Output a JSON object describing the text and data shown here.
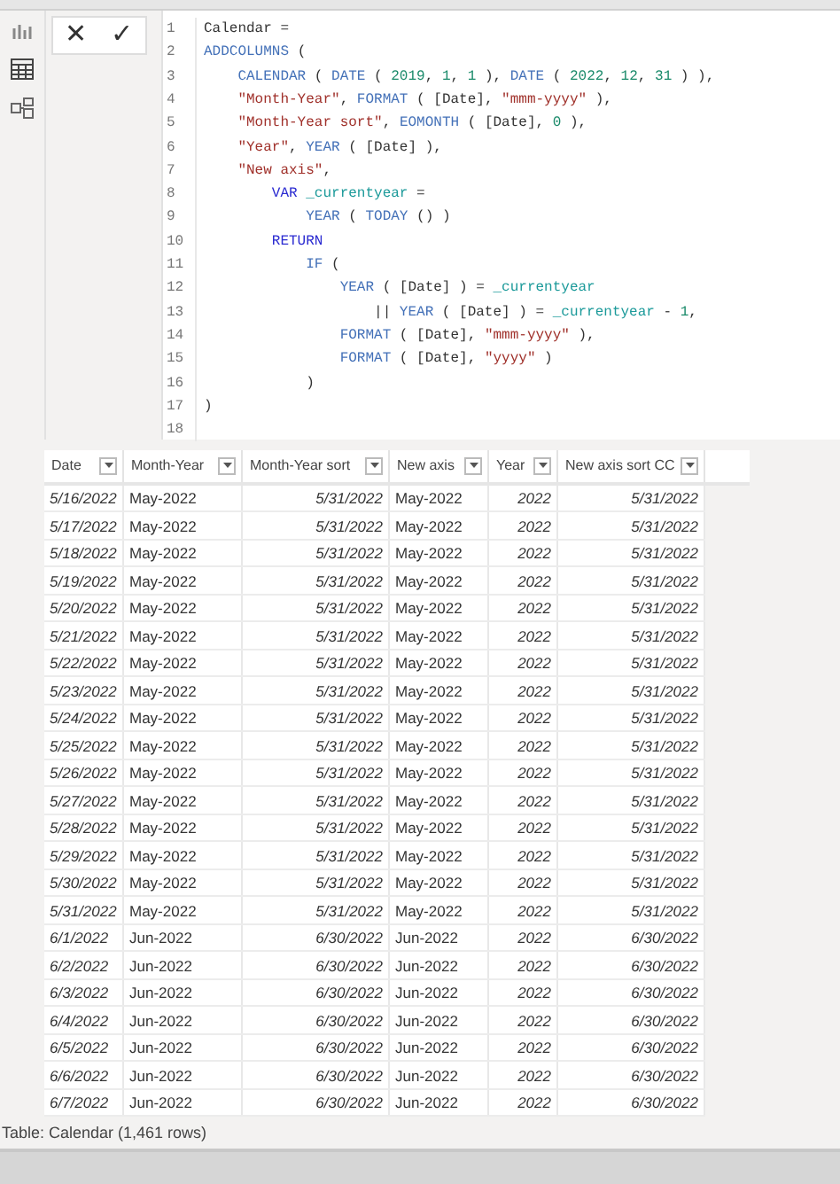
{
  "formula_bar": {
    "cancel": "✕",
    "commit": "✓"
  },
  "code": [
    {
      "n": "1",
      "tokens": [
        {
          "kind": "txt",
          "t": "Calendar ="
        }
      ]
    },
    {
      "n": "2",
      "tokens": [
        {
          "kind": "fn",
          "t": "ADDCOLUMNS"
        },
        {
          "kind": "txt",
          "t": " ("
        }
      ]
    },
    {
      "n": "3",
      "tokens": [
        {
          "kind": "fn",
          "t": "    CALENDAR"
        },
        {
          "kind": "txt",
          "t": " ( "
        },
        {
          "kind": "fn",
          "t": "DATE"
        },
        {
          "kind": "txt",
          "t": " ( "
        },
        {
          "kind": "num",
          "t": "2019"
        },
        {
          "kind": "txt",
          "t": ", "
        },
        {
          "kind": "num",
          "t": "1"
        },
        {
          "kind": "txt",
          "t": ", "
        },
        {
          "kind": "num",
          "t": "1"
        },
        {
          "kind": "txt",
          "t": " ), "
        },
        {
          "kind": "fn",
          "t": "DATE"
        },
        {
          "kind": "txt",
          "t": " ( "
        },
        {
          "kind": "num",
          "t": "2022"
        },
        {
          "kind": "txt",
          "t": ", "
        },
        {
          "kind": "num",
          "t": "12"
        },
        {
          "kind": "txt",
          "t": ", "
        },
        {
          "kind": "num",
          "t": "31"
        },
        {
          "kind": "txt",
          "t": " ) ),"
        }
      ]
    },
    {
      "n": "4",
      "tokens": [
        {
          "kind": "str",
          "t": "    \"Month-Year\""
        },
        {
          "kind": "txt",
          "t": ", "
        },
        {
          "kind": "fn",
          "t": "FORMAT"
        },
        {
          "kind": "txt",
          "t": " ( [Date], "
        },
        {
          "kind": "str",
          "t": "\"mmm-yyyy\""
        },
        {
          "kind": "txt",
          "t": " ),"
        }
      ]
    },
    {
      "n": "5",
      "tokens": [
        {
          "kind": "str",
          "t": "    \"Month-Year sort\""
        },
        {
          "kind": "txt",
          "t": ", "
        },
        {
          "kind": "fn",
          "t": "EOMONTH"
        },
        {
          "kind": "txt",
          "t": " ( [Date], "
        },
        {
          "kind": "num",
          "t": "0"
        },
        {
          "kind": "txt",
          "t": " ),"
        }
      ]
    },
    {
      "n": "6",
      "tokens": [
        {
          "kind": "str",
          "t": "    \"Year\""
        },
        {
          "kind": "txt",
          "t": ", "
        },
        {
          "kind": "fn",
          "t": "YEAR"
        },
        {
          "kind": "txt",
          "t": " ( [Date] ),"
        }
      ]
    },
    {
      "n": "7",
      "tokens": [
        {
          "kind": "str",
          "t": "    \"New axis\""
        },
        {
          "kind": "txt",
          "t": ","
        }
      ]
    },
    {
      "n": "8",
      "tokens": [
        {
          "kind": "kw",
          "t": "        VAR"
        },
        {
          "kind": "var",
          "t": " _currentyear"
        },
        {
          "kind": "txt",
          "t": " ="
        }
      ]
    },
    {
      "n": "9",
      "tokens": [
        {
          "kind": "fn",
          "t": "            YEAR"
        },
        {
          "kind": "txt",
          "t": " ( "
        },
        {
          "kind": "fn",
          "t": "TODAY"
        },
        {
          "kind": "txt",
          "t": " () )"
        }
      ]
    },
    {
      "n": "10",
      "tokens": [
        {
          "kind": "kw",
          "t": "        RETURN"
        }
      ]
    },
    {
      "n": "11",
      "tokens": [
        {
          "kind": "fn",
          "t": "            IF"
        },
        {
          "kind": "txt",
          "t": " ("
        }
      ]
    },
    {
      "n": "12",
      "tokens": [
        {
          "kind": "fn",
          "t": "                YEAR"
        },
        {
          "kind": "txt",
          "t": " ( [Date] ) = "
        },
        {
          "kind": "var",
          "t": "_currentyear"
        }
      ]
    },
    {
      "n": "13",
      "tokens": [
        {
          "kind": "txt",
          "t": "                    || "
        },
        {
          "kind": "fn",
          "t": "YEAR"
        },
        {
          "kind": "txt",
          "t": " ( [Date] ) = "
        },
        {
          "kind": "var",
          "t": "_currentyear"
        },
        {
          "kind": "txt",
          "t": " - "
        },
        {
          "kind": "num",
          "t": "1"
        },
        {
          "kind": "txt",
          "t": ","
        }
      ]
    },
    {
      "n": "14",
      "tokens": [
        {
          "kind": "fn",
          "t": "                FORMAT"
        },
        {
          "kind": "txt",
          "t": " ( [Date], "
        },
        {
          "kind": "str",
          "t": "\"mmm-yyyy\""
        },
        {
          "kind": "txt",
          "t": " ),"
        }
      ]
    },
    {
      "n": "15",
      "tokens": [
        {
          "kind": "fn",
          "t": "                FORMAT"
        },
        {
          "kind": "txt",
          "t": " ( [Date], "
        },
        {
          "kind": "str",
          "t": "\"yyyy\""
        },
        {
          "kind": "txt",
          "t": " )"
        }
      ]
    },
    {
      "n": "16",
      "tokens": [
        {
          "kind": "txt",
          "t": "            )"
        }
      ]
    },
    {
      "n": "17",
      "tokens": [
        {
          "kind": "txt",
          "t": ")"
        }
      ]
    },
    {
      "n": "18"
    }
  ],
  "table": {
    "columns": [
      {
        "label": "Date",
        "kind": "key"
      },
      {
        "label": "Month-Year",
        "kind": "text"
      },
      {
        "label": "Month-Year sort",
        "kind": "value"
      },
      {
        "label": "New axis",
        "kind": "text"
      },
      {
        "label": "Year",
        "kind": "value"
      },
      {
        "label": "New axis sort CC",
        "kind": "value"
      }
    ],
    "rows": [
      [
        "5/16/2022",
        "May-2022",
        "5/31/2022",
        "May-2022",
        "2022",
        "5/31/2022"
      ],
      [
        "5/17/2022",
        "May-2022",
        "5/31/2022",
        "May-2022",
        "2022",
        "5/31/2022"
      ],
      [
        "5/18/2022",
        "May-2022",
        "5/31/2022",
        "May-2022",
        "2022",
        "5/31/2022"
      ],
      [
        "5/19/2022",
        "May-2022",
        "5/31/2022",
        "May-2022",
        "2022",
        "5/31/2022"
      ],
      [
        "5/20/2022",
        "May-2022",
        "5/31/2022",
        "May-2022",
        "2022",
        "5/31/2022"
      ],
      [
        "5/21/2022",
        "May-2022",
        "5/31/2022",
        "May-2022",
        "2022",
        "5/31/2022"
      ],
      [
        "5/22/2022",
        "May-2022",
        "5/31/2022",
        "May-2022",
        "2022",
        "5/31/2022"
      ],
      [
        "5/23/2022",
        "May-2022",
        "5/31/2022",
        "May-2022",
        "2022",
        "5/31/2022"
      ],
      [
        "5/24/2022",
        "May-2022",
        "5/31/2022",
        "May-2022",
        "2022",
        "5/31/2022"
      ],
      [
        "5/25/2022",
        "May-2022",
        "5/31/2022",
        "May-2022",
        "2022",
        "5/31/2022"
      ],
      [
        "5/26/2022",
        "May-2022",
        "5/31/2022",
        "May-2022",
        "2022",
        "5/31/2022"
      ],
      [
        "5/27/2022",
        "May-2022",
        "5/31/2022",
        "May-2022",
        "2022",
        "5/31/2022"
      ],
      [
        "5/28/2022",
        "May-2022",
        "5/31/2022",
        "May-2022",
        "2022",
        "5/31/2022"
      ],
      [
        "5/29/2022",
        "May-2022",
        "5/31/2022",
        "May-2022",
        "2022",
        "5/31/2022"
      ],
      [
        "5/30/2022",
        "May-2022",
        "5/31/2022",
        "May-2022",
        "2022",
        "5/31/2022"
      ],
      [
        "5/31/2022",
        "May-2022",
        "5/31/2022",
        "May-2022",
        "2022",
        "5/31/2022"
      ],
      [
        "6/1/2022",
        "Jun-2022",
        "6/30/2022",
        "Jun-2022",
        "2022",
        "6/30/2022"
      ],
      [
        "6/2/2022",
        "Jun-2022",
        "6/30/2022",
        "Jun-2022",
        "2022",
        "6/30/2022"
      ],
      [
        "6/3/2022",
        "Jun-2022",
        "6/30/2022",
        "Jun-2022",
        "2022",
        "6/30/2022"
      ],
      [
        "6/4/2022",
        "Jun-2022",
        "6/30/2022",
        "Jun-2022",
        "2022",
        "6/30/2022"
      ],
      [
        "6/5/2022",
        "Jun-2022",
        "6/30/2022",
        "Jun-2022",
        "2022",
        "6/30/2022"
      ],
      [
        "6/6/2022",
        "Jun-2022",
        "6/30/2022",
        "Jun-2022",
        "2022",
        "6/30/2022"
      ],
      [
        "6/7/2022",
        "Jun-2022",
        "6/30/2022",
        "Jun-2022",
        "2022",
        "6/30/2022"
      ]
    ]
  },
  "status_bar": "Table: Calendar (1,461 rows)"
}
